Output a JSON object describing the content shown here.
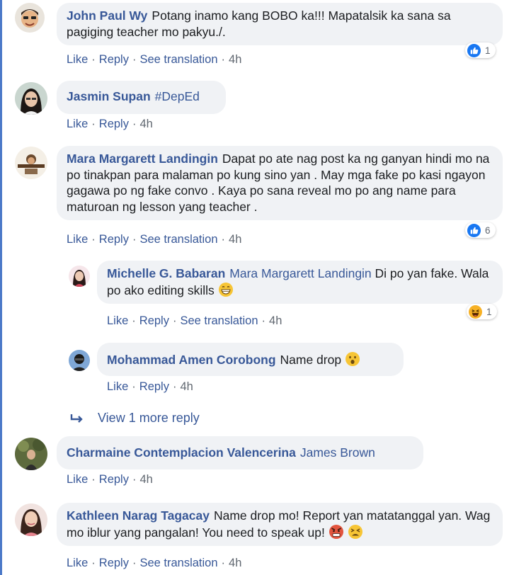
{
  "actions": {
    "like": "Like",
    "reply": "Reply",
    "translate": "See translation"
  },
  "comments": [
    {
      "author": "John Paul Wy",
      "text": "Potang inamo kang BOBO ka!!! Mapatalsik ka sana sa pagiging teacher mo pakyu./.",
      "time": "4h",
      "reaction_count": "1"
    },
    {
      "author": "Jasmin Supan",
      "hashtag": "#DepEd",
      "time": "4h"
    },
    {
      "author": "Mara Margarett Landingin",
      "text": "Dapat po ate nag post ka ng ganyan hindi mo na po tinakpan para malaman po kung sino yan . May mga fake po kasi ngayon gagawa po ng fake convo . Kaya po sana reveal mo po ang name para maturoan ng lesson yang teacher .",
      "time": "4h",
      "reaction_count": "6"
    },
    {
      "author": "Michelle G. Babaran",
      "mention": "Mara Margarett Landingin",
      "text": "Di po yan fake. Wala po ako editing skills",
      "time": "4h",
      "reaction_count": "1"
    },
    {
      "author": "Mohammad Amen Corobong",
      "text": "Name drop",
      "time": "4h"
    },
    {
      "author": "Charmaine Contemplacion Valencerina",
      "mention": "James Brown",
      "time": "4h"
    },
    {
      "author": "Kathleen Narag Tagacay",
      "text": "Name drop mo! Report yan matatanggal yan. Wag mo iblur yang pangalan! You need to speak up!",
      "time": "4h"
    }
  ],
  "view_more": "View 1 more reply",
  "colors": {
    "link": "#385898",
    "bubble": "#f0f2f5",
    "meta": "#606770",
    "like_blue": "#1877f2"
  },
  "icons": [
    "like-icon",
    "haha-icon",
    "grin-emoji-icon",
    "hushed-emoji-icon",
    "angry-emoji-icon",
    "tired-emoji-icon",
    "reply-arrow-icon"
  ]
}
